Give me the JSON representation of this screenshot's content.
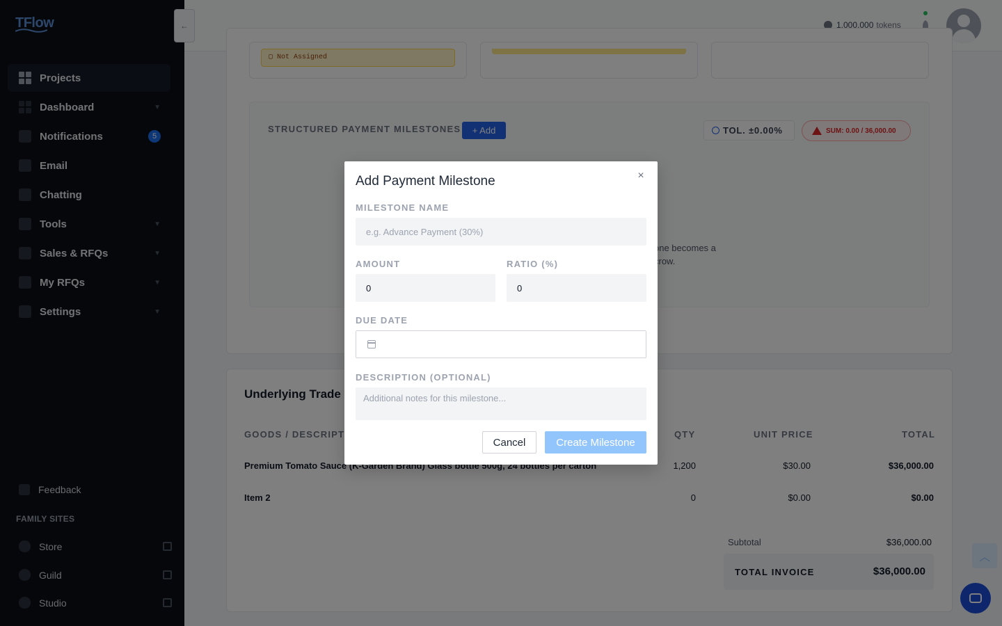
{
  "app": {
    "logo": "TFlow"
  },
  "sidebar": {
    "items": [
      {
        "label": "Projects"
      },
      {
        "label": "Dashboard"
      },
      {
        "label": "Notifications",
        "badge": "5"
      },
      {
        "label": "Email"
      },
      {
        "label": "Chatting"
      },
      {
        "label": "Tools"
      },
      {
        "label": "Sales & RFQs"
      },
      {
        "label": "My RFQs"
      },
      {
        "label": "Settings"
      }
    ],
    "feedback": "Feedback",
    "family_title": "FAMILY SITES",
    "family_sites": [
      {
        "label": "Store"
      },
      {
        "label": "Guild"
      },
      {
        "label": "Studio"
      }
    ],
    "collapse_icon": "←"
  },
  "header": {
    "tokens_value": "1,000,000",
    "tokens_unit": "tokens"
  },
  "main": {
    "not_assigned": "Not Assigned",
    "milestones_title": "STRUCTURED PAYMENT MILESTONES",
    "add_label": "+ Add",
    "tolerance": "TOL. ±0.00%",
    "sum": "SUM: 0.00 / 36,000.00",
    "empty_line1": "one becomes a",
    "empty_line2": "crow.",
    "trade_title": "Underlying Trade I",
    "table": {
      "headers": [
        "GOODS / DESCRIPTI",
        "QTY",
        "UNIT PRICE",
        "TOTAL"
      ],
      "rows": [
        {
          "desc": "Premium Tomato Sauce (K-Garden Brand) Glass bottle 500g, 24 bottles per carton",
          "qty": "1,200",
          "unit": "$30.00",
          "total": "$36,000.00"
        },
        {
          "desc": "Item 2",
          "qty": "0",
          "unit": "$0.00",
          "total": "$0.00"
        }
      ]
    },
    "subtotal_label": "Subtotal",
    "subtotal_value": "$36,000.00",
    "total_label": "TOTAL INVOICE",
    "total_value": "$36,000.00"
  },
  "modal": {
    "title": "Add Payment Milestone",
    "close": "×",
    "name_label": "MILESTONE NAME",
    "name_placeholder": "e.g. Advance Payment (30%)",
    "amount_label": "AMOUNT",
    "amount_value": "0",
    "ratio_label": "RATIO (%)",
    "ratio_value": "0",
    "due_label": "DUE DATE",
    "desc_label": "DESCRIPTION (OPTIONAL)",
    "desc_placeholder": "Additional notes for this milestone...",
    "cancel": "Cancel",
    "create": "Create Milestone"
  },
  "colors": {
    "sidebar_bg": "#0b0f17",
    "accent": "#2563eb",
    "badge": "#1d6ef0",
    "create_disabled": "#93c5fd",
    "danger": "#dc2626"
  }
}
